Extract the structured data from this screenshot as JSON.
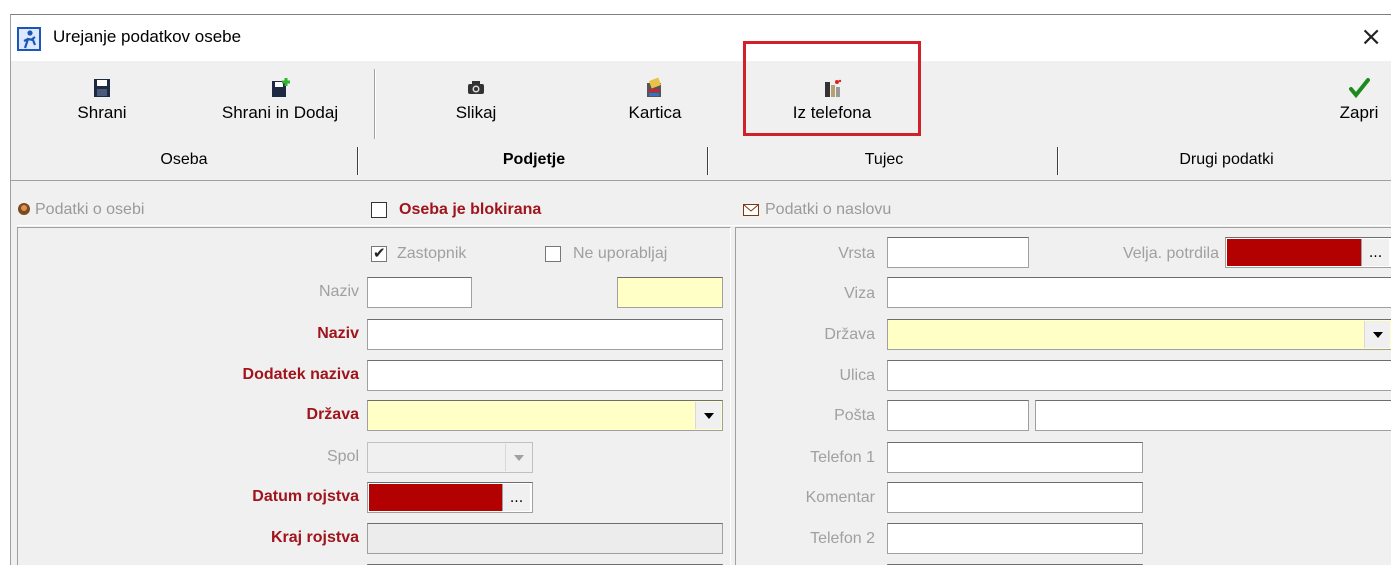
{
  "window": {
    "title": "Urejanje podatkov osebe",
    "close_glyph": "×"
  },
  "toolbar": {
    "save": {
      "label": "Shrani",
      "icon": "floppy-disk-icon"
    },
    "save_add": {
      "label": "Shrani in Dodaj",
      "icon": "floppy-add-icon"
    },
    "photo": {
      "label": "Slikaj",
      "icon": "camera-icon"
    },
    "card": {
      "label": "Kartica",
      "icon": "card-reader-icon"
    },
    "phone": {
      "label": "Iz telefona",
      "icon": "phone-icon"
    },
    "close": {
      "label": "Zapri",
      "icon": "checkmark-icon"
    }
  },
  "tabs": [
    "Oseba",
    "Podjetje",
    "Tujec",
    "Drugi podatki"
  ],
  "active_tab": "Podjetje",
  "left_group": {
    "title": "Podatki o osebi",
    "blocked_label": "Oseba je blokirana",
    "blocked_checked": false,
    "representative_label": "Zastopnik",
    "representative_checked": true,
    "dont_use_label": "Ne uporabljaj",
    "dont_use_checked": false,
    "fields": {
      "naziv_small": "Naziv",
      "naziv": "Naziv",
      "dodatek": "Dodatek naziva",
      "drzava": "Država",
      "spol": "Spol",
      "datum": "Datum rojstva",
      "kraj": "Kraj rojstva"
    },
    "date_button": "..."
  },
  "right_group": {
    "title": "Podatki o naslovu",
    "fields": {
      "vrsta": "Vrsta",
      "velja": "Velja. potrdila",
      "viza": "Viza",
      "drzava": "Država",
      "ulica": "Ulica",
      "posta": "Pošta",
      "telefon1": "Telefon 1",
      "komentar": "Komentar",
      "telefon2": "Telefon 2"
    },
    "date_button": "..."
  },
  "colors": {
    "highlight": "#d0202a",
    "required_label": "#a0141c",
    "date_fill": "#b30000",
    "yellow_field": "#ffffc6"
  }
}
